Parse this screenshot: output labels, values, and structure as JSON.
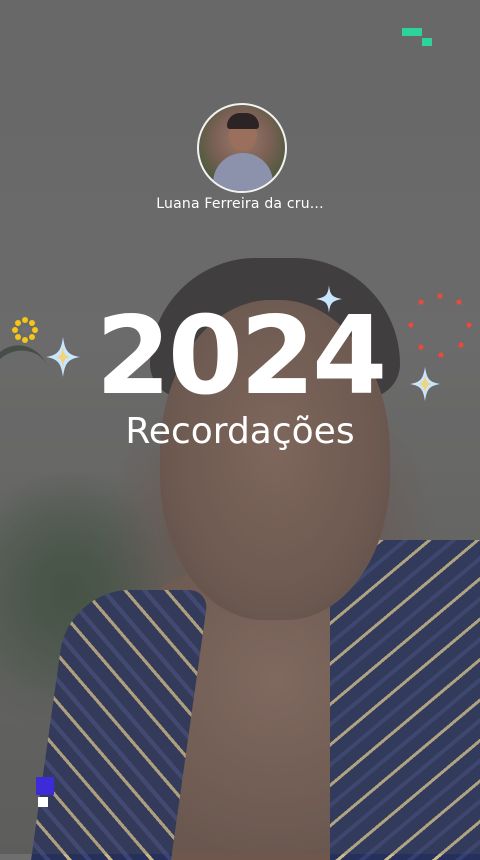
{
  "profile": {
    "name": "Luana Ferreira da cru..."
  },
  "headline": {
    "year": "2024",
    "title": "Recordações"
  },
  "colors": {
    "sparkle_blue": "#c9e6ff",
    "sparkle_gold": "#f2c94c",
    "flower_yellow": "#f5c518",
    "dots_red": "#e84a3c",
    "pixel_green": "#2ed39a",
    "pixel_blue": "#3d2bd9"
  },
  "icons": [
    "sparkle-icon",
    "flower-icon",
    "dotted-ring-icon",
    "pixel-deco-icon"
  ]
}
